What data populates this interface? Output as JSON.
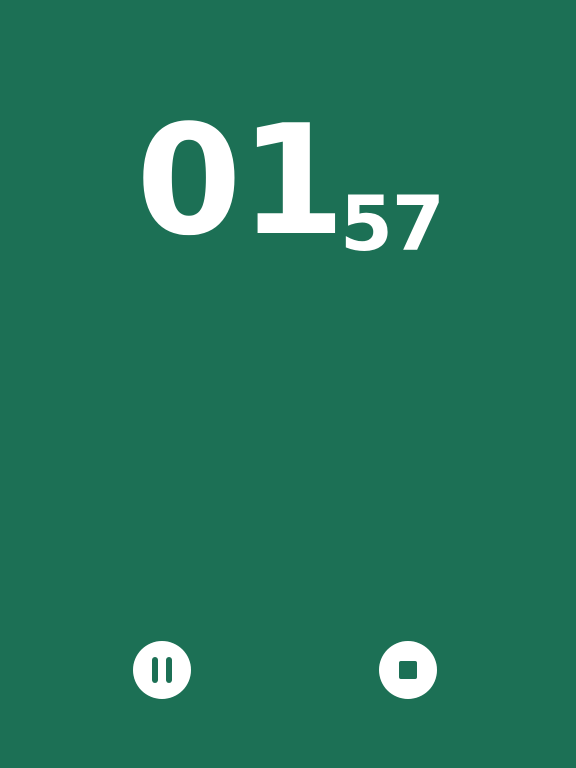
{
  "colors": {
    "background": "#1c7055",
    "foreground": "#ffffff"
  },
  "timer": {
    "minutes": "01",
    "seconds": "57"
  },
  "controls": {
    "pause": {
      "icon": "pause-icon"
    },
    "stop": {
      "icon": "stop-icon"
    }
  }
}
